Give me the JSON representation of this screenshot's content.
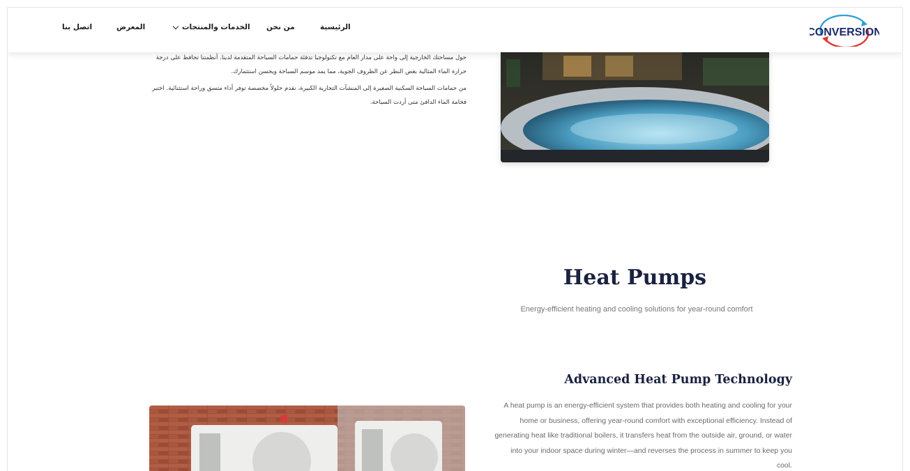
{
  "nav": {
    "home": "الرئيسية",
    "about": "من نحن",
    "services": "الخدمات والمنتجات",
    "gallery": "المعرض",
    "contact": "اتصل بنا"
  },
  "logo": {
    "text": "CONVERSION",
    "brand_color": "#1a2a6c",
    "accent_color": "#e3342f",
    "ring_color": "#2f9fd8"
  },
  "intro": {
    "paragraph_1": "حول مساحتك الخارجية إلى واحة على مدار العام مع تكنولوجيا تدفئة حمامات السباحة المتقدمة لدينا. أنظمتنا تحافظ على درجة حرارة الماء المثالية بغض النظر عن الظروف الجوية، مما يمد موسم السباحة ويحسن استثمارك.",
    "paragraph_2": "من حمامات السباحة السكنية الصغيرة إلى المنشآت التجارية الكبيرة، نقدم حلولاً مخصصة توفر أداء متسق وراحة استثنائية. اختبر فخامة الماء الدافئ متى أردت السباحة."
  },
  "heat_pumps": {
    "title": "Heat Pumps",
    "subtitle": "Energy-efficient heating and cooling solutions for year-round comfort",
    "feature_title": "Advanced Heat Pump Technology",
    "feature_text": "A heat pump is an energy-efficient system that provides both heating and cooling for your home or business, offering year-round comfort with exceptional efficiency. Instead of generating heat like traditional boilers, it transfers heat from the outside air, ground, or water into your indoor space during winter—and reverses the process in summer to keep you cool."
  },
  "colors": {
    "heading": "#1a2240",
    "muted_text": "#6b6b6b"
  }
}
